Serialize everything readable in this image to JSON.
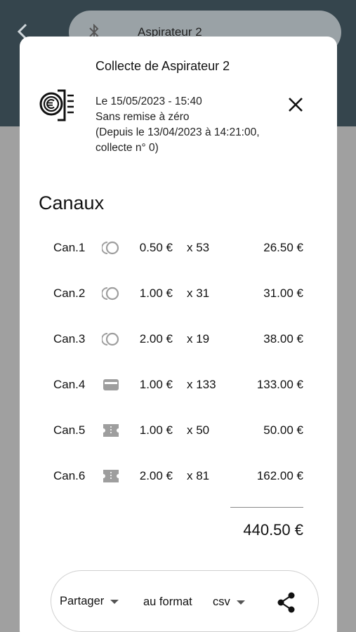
{
  "background": {
    "back_icon": "chevron-left-icon",
    "device_name": "Aspirateur 2",
    "device_icon": "bluetooth-icon"
  },
  "sheet": {
    "title": "Collecte de Aspirateur 2",
    "date": "Le 15/05/2023 - 15:40",
    "reset": "Sans remise à zéro",
    "since": "(Depuis le 13/04/2023 à 14:21:00, collecte n° 0)",
    "icon": "coin-collector-icon",
    "close_icon": "close-icon"
  },
  "channels": {
    "title": "Canaux",
    "rows": [
      {
        "name": "Can.1",
        "type": "coin",
        "unit": "0.50 €",
        "qty": "x 53",
        "total": "26.50 €"
      },
      {
        "name": "Can.2",
        "type": "coin",
        "unit": "1.00 €",
        "qty": "x 31",
        "total": "31.00 €"
      },
      {
        "name": "Can.3",
        "type": "coin",
        "unit": "2.00 €",
        "qty": "x 19",
        "total": "38.00 €"
      },
      {
        "name": "Can.4",
        "type": "card",
        "unit": "1.00 €",
        "qty": "x 133",
        "total": "133.00 €"
      },
      {
        "name": "Can.5",
        "type": "token",
        "unit": "1.00 €",
        "qty": "x 50",
        "total": "50.00 €"
      },
      {
        "name": "Can.6",
        "type": "token",
        "unit": "2.00 €",
        "qty": "x 81",
        "total": "162.00 €"
      }
    ],
    "grand_total": "440.50 €"
  },
  "share": {
    "action": "Partager",
    "format_label": "au format",
    "format_value": "csv",
    "share_icon": "share-icon"
  },
  "colors": {
    "header_bg": "#35454d",
    "overlay": "#a0a0a0",
    "sheet_bg": "#ffffff",
    "icon_gray": "#9e9e9e"
  }
}
